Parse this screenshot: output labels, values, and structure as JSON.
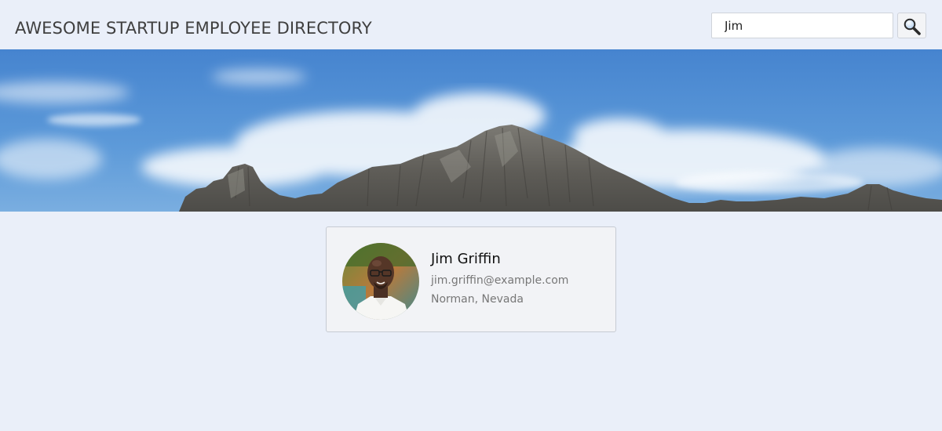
{
  "header": {
    "title": "AWESOME STARTUP EMPLOYEE DIRECTORY"
  },
  "search": {
    "value": "Jim",
    "button_icon": "magnifier-icon"
  },
  "banner": {
    "image": "mountain-sky-banner"
  },
  "results": [
    {
      "name": "Jim Griffin",
      "email": "jim.griffin@example.com",
      "location": "Norman, Nevada",
      "avatar": "employee-avatar"
    }
  ],
  "colors": {
    "background": "#eaeff9",
    "card_background": "#f2f3f6",
    "card_border": "#c6cbd3",
    "sky": "#4a8ed6"
  }
}
